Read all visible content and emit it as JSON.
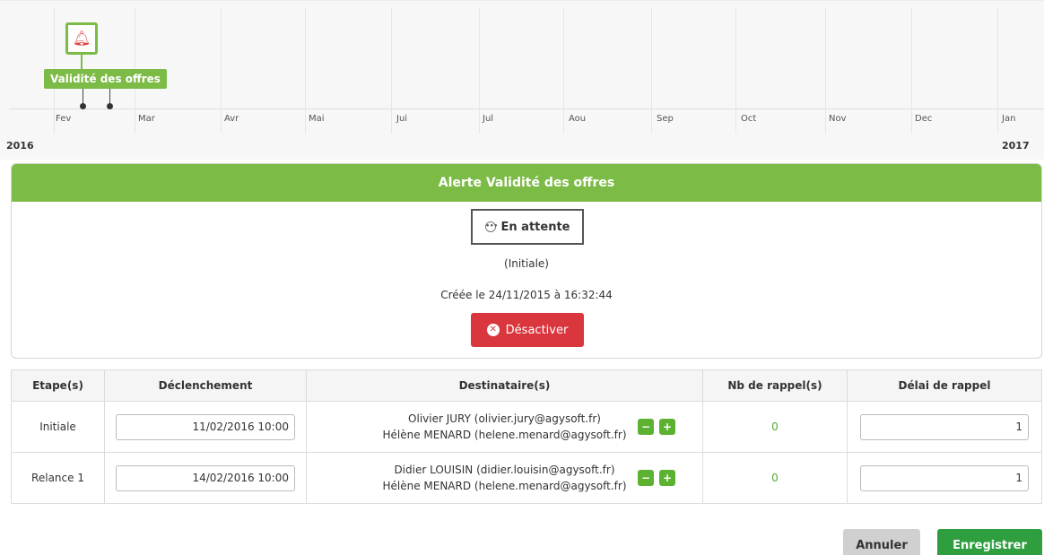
{
  "timeline": {
    "months": [
      "Fev",
      "Mar",
      "Avr",
      "Mai",
      "Jui",
      "Jul",
      "Aou",
      "Sep",
      "Oct",
      "Nov",
      "Dec",
      "Jan"
    ],
    "year_start": "2016",
    "year_end": "2017",
    "event_label": "Validité des offres",
    "event_icon": "bell-icon"
  },
  "alert": {
    "title": "Alerte Validité des offres",
    "status": "En attente",
    "status_icon": "ellipsis-icon",
    "step": "(Initiale)",
    "created": "Créée le 24/11/2015 à 16:32:44",
    "deactivate_label": "Désactiver",
    "deactivate_icon": "times-circle-icon"
  },
  "table": {
    "headers": [
      "Etape(s)",
      "Déclenchement",
      "Destinataire(s)",
      "Nb de rappel(s)",
      "Délai de rappel"
    ],
    "rows": [
      {
        "step": "Initiale",
        "trigger": "11/02/2016 10:00",
        "recipients": [
          "Olivier JURY (olivier.jury@agysoft.fr)",
          "Hélène MENARD (helene.menard@agysoft.fr)"
        ],
        "reminders": "0",
        "delay": "1"
      },
      {
        "step": "Relance 1",
        "trigger": "14/02/2016 10:00",
        "recipients": [
          "Didier LOUISIN (didier.louisin@agysoft.fr)",
          "Hélène MENARD (helene.menard@agysoft.fr)"
        ],
        "reminders": "0",
        "delay": "1"
      }
    ],
    "minus_label": "−",
    "plus_label": "+"
  },
  "footer": {
    "cancel_label": "Annuler",
    "save_label": "Enregistrer"
  },
  "colors": {
    "green": "#7dbb47",
    "danger": "#d9363e",
    "save": "#2f9e3f"
  }
}
